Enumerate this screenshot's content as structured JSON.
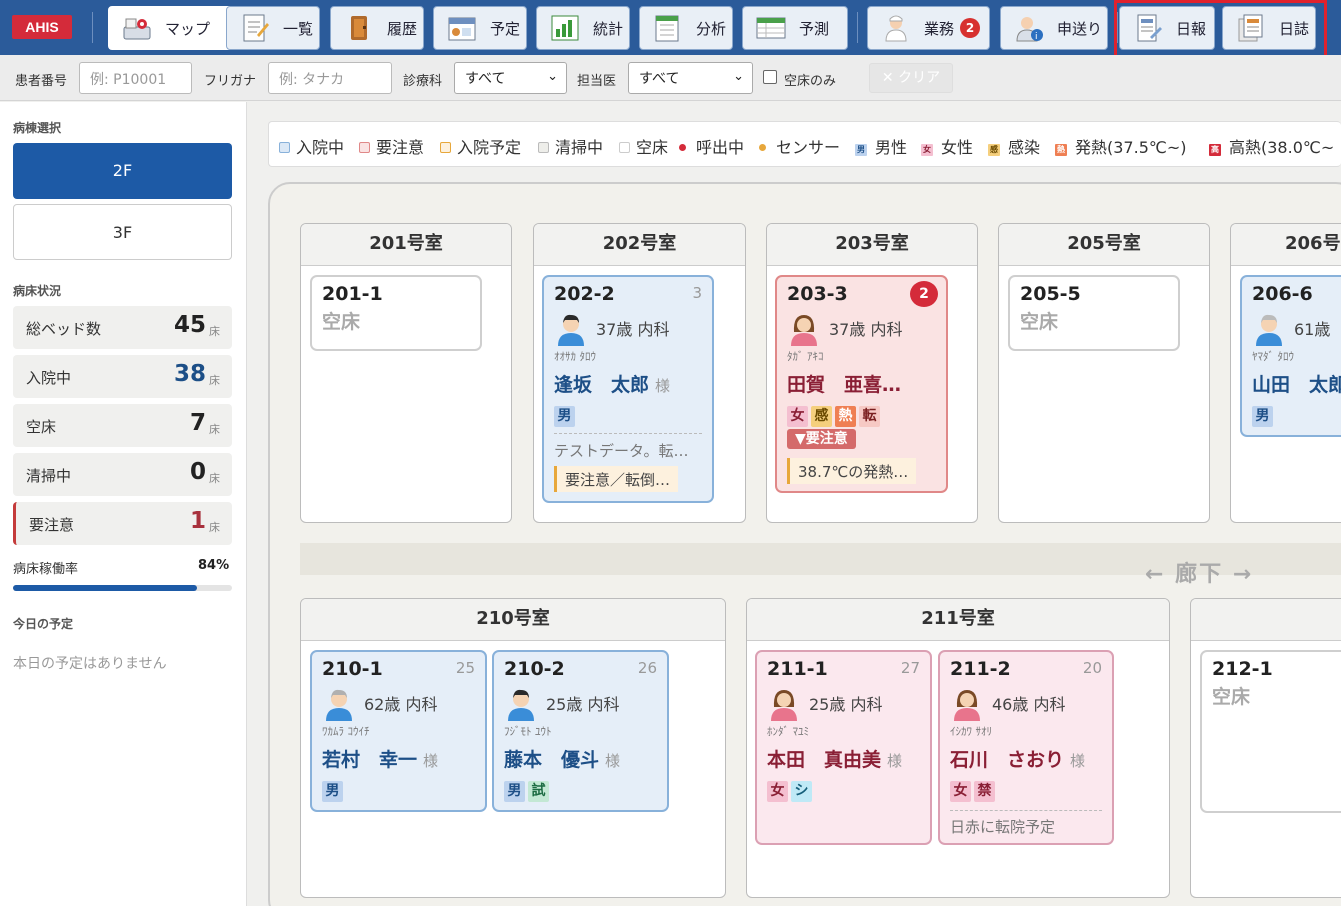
{
  "app": {
    "logo": "AHIS"
  },
  "nav": [
    {
      "label": "マップ",
      "icon": "map-icon",
      "active": true
    },
    {
      "label": "一覧",
      "icon": "list-icon"
    },
    {
      "label": "履歴",
      "icon": "history-icon"
    },
    {
      "label": "予定",
      "icon": "schedule-icon"
    },
    {
      "label": "統計",
      "icon": "statistics-icon"
    },
    {
      "label": "分析",
      "icon": "analysis-icon"
    },
    {
      "label": "予測",
      "icon": "forecast-icon"
    },
    {
      "label": "業務",
      "icon": "nurse-icon",
      "badge": "2"
    },
    {
      "label": "申送り",
      "icon": "handover-icon"
    },
    {
      "label": "日報",
      "icon": "daily-report-icon"
    },
    {
      "label": "日誌",
      "icon": "journal-icon"
    }
  ],
  "filters": {
    "patient_id_label": "患者番号",
    "patient_id_placeholder": "例: P10001",
    "furigana_label": "フリガナ",
    "furigana_placeholder": "例: タナカ",
    "department_label": "診療科",
    "department_value": "すべて",
    "doctor_label": "担当医",
    "doctor_value": "すべて",
    "vacant_only_label": "空床のみ",
    "clear_label": "✕ クリア"
  },
  "sidebar": {
    "ward_heading": "病棟選択",
    "wards": [
      "2F",
      "3F"
    ],
    "status_heading": "病床状況",
    "stats": [
      {
        "label": "総ベッド数",
        "value": "45",
        "unit": "床"
      },
      {
        "label": "入院中",
        "value": "38",
        "unit": "床",
        "color": "#1d4f87"
      },
      {
        "label": "空床",
        "value": "7",
        "unit": "床"
      },
      {
        "label": "清掃中",
        "value": "0",
        "unit": "床"
      },
      {
        "label": "要注意",
        "value": "1",
        "unit": "床",
        "color": "#a8313d"
      }
    ],
    "occupancy_label": "病床稼働率",
    "occupancy_value": "84%",
    "occupancy_fraction": 0.84,
    "today_heading": "今日の予定",
    "today_empty": "本日の予定はありません"
  },
  "legend": [
    {
      "kind": "sq",
      "label": "入院中",
      "color": "#dbe8f6",
      "border": "#88b1da"
    },
    {
      "kind": "sq",
      "label": "要注意",
      "color": "#fae3e3",
      "border": "#e08888"
    },
    {
      "kind": "sq",
      "label": "入院予定",
      "color": "#fdf1de",
      "border": "#e7a73b"
    },
    {
      "kind": "sq",
      "label": "清掃中",
      "color": "#eeeeea",
      "border": "#bbb"
    },
    {
      "kind": "sq",
      "label": "空床",
      "color": "#ffffff",
      "border": "#ccc"
    },
    {
      "kind": "dot",
      "label": "呼出中",
      "color": "#d42b3a"
    },
    {
      "kind": "dot",
      "label": "センサー",
      "color": "#e7a73b"
    },
    {
      "kind": "mini",
      "label": "男性",
      "mark": "男",
      "color": "#bcd2ee",
      "fg": "#1d4f87"
    },
    {
      "kind": "mini",
      "label": "女性",
      "mark": "女",
      "color": "#f4bfd0",
      "fg": "#8a1f35"
    },
    {
      "kind": "mini",
      "label": "感染",
      "mark": "感",
      "color": "#f5cf7d",
      "fg": "#6a4a00"
    },
    {
      "kind": "mini",
      "label": "発熱(37.5℃~)",
      "mark": "熱",
      "color": "#ef7f53",
      "fg": "#fff"
    },
    {
      "kind": "mini",
      "label": "高熱(38.0℃~",
      "mark": "高",
      "color": "#d42b3a",
      "fg": "#fff"
    }
  ],
  "rooms": {
    "r201": {
      "name": "201号室"
    },
    "r202": {
      "name": "202号室"
    },
    "r203": {
      "name": "203号室"
    },
    "r205": {
      "name": "205号室"
    },
    "r206": {
      "name": "206号"
    },
    "r210": {
      "name": "210号室"
    },
    "r211": {
      "name": "211号室"
    }
  },
  "beds": {
    "b201_1": {
      "id": "201-1",
      "empty": "空床"
    },
    "b202_2": {
      "id": "202-2",
      "num": "3",
      "age": "37歳 内科",
      "kana": "ｵｵｻｶ ﾀﾛｳ",
      "name": "逢坂　太郎",
      "sama": "様",
      "tags": [
        "男"
      ],
      "note": "テストデータ。転…",
      "care": "要注意／転倒…"
    },
    "b203_3": {
      "id": "203-3",
      "call": "2",
      "age": "37歳 内科",
      "kana": "ﾀｶﾞ ｱｷｺ",
      "name": "田賀　亜喜…",
      "tags": [
        "女",
        "感",
        "熱",
        "転"
      ],
      "warn": "▼要注意",
      "care": "38.7℃の発熱…"
    },
    "b205_5": {
      "id": "205-5",
      "empty": "空床"
    },
    "b206_6": {
      "id": "206-6",
      "age": "61歳",
      "kana": "ﾔﾏﾀﾞ ﾀﾛｳ",
      "name": "山田　太郎",
      "tags": [
        "男"
      ]
    },
    "b210_1": {
      "id": "210-1",
      "num": "25",
      "age": "62歳 内科",
      "kana": "ﾜｶﾑﾗ ｺｳｲﾁ",
      "name": "若村　幸一",
      "sama": "様",
      "tags": [
        "男"
      ]
    },
    "b210_2": {
      "id": "210-2",
      "num": "26",
      "age": "25歳 内科",
      "kana": "ﾌｼﾞﾓﾄ ﾕｳﾄ",
      "name": "藤本　優斗",
      "sama": "様",
      "tags": [
        "男",
        "試"
      ]
    },
    "b211_1": {
      "id": "211-1",
      "num": "27",
      "age": "25歳 内科",
      "kana": "ﾎﾝﾀﾞ ﾏﾕﾐ",
      "name": "本田　真由美",
      "sama": "様",
      "tags": [
        "女",
        "シ"
      ]
    },
    "b211_2": {
      "id": "211-2",
      "num": "20",
      "age": "46歳 内科",
      "kana": "ｲｼｶﾜ ｻｵﾘ",
      "name": "石川　さおり",
      "sama": "様",
      "tags": [
        "女",
        "禁"
      ],
      "note": "日赤に転院予定"
    },
    "b212_1": {
      "id": "212-1",
      "empty": "空床"
    }
  },
  "corridor": "← 廊下 →"
}
